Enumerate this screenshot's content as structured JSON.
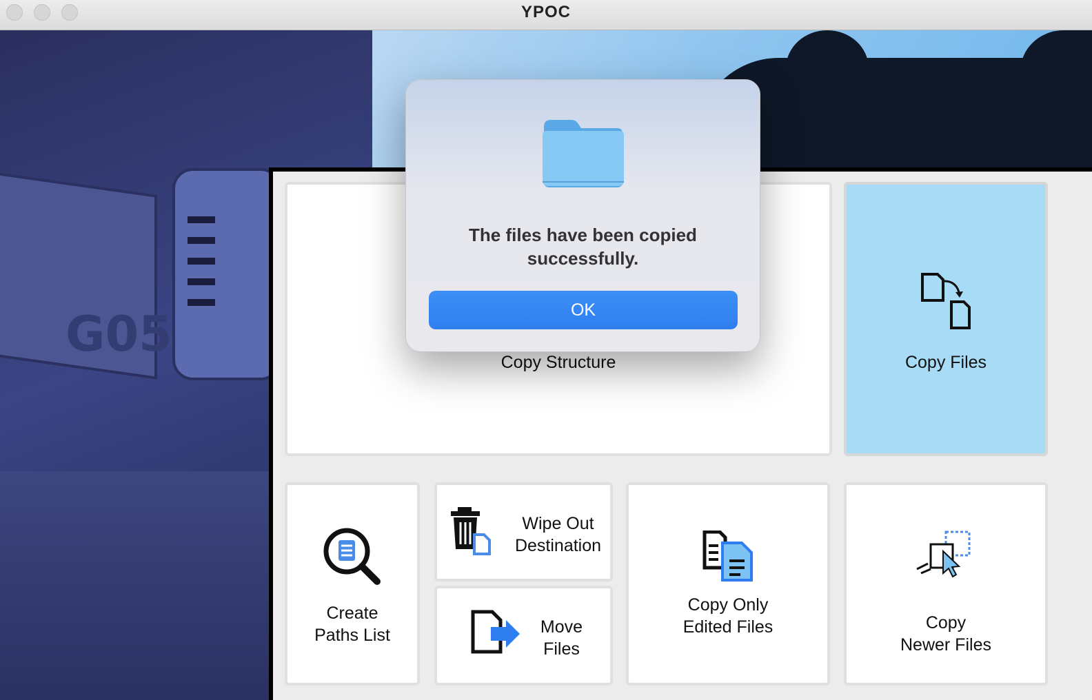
{
  "window": {
    "title": "YPOC"
  },
  "wallpaper": {
    "text": "G05"
  },
  "tiles": {
    "copy_structure": "Copy Structure",
    "copy_files": "Copy Files",
    "create_paths_list": [
      "Create",
      "Paths List"
    ],
    "wipe_out_destination": [
      "Wipe Out",
      "Destination"
    ],
    "move_files": [
      "Move",
      "Files"
    ],
    "copy_only_edited_files": [
      "Copy Only",
      "Edited Files"
    ],
    "copy_newer_files": [
      "Copy",
      "Newer Files"
    ]
  },
  "dialog": {
    "message_line1": "The files have been copied",
    "message_line2": "successfully.",
    "ok_label": "OK"
  },
  "colors": {
    "accent": "#2f7ef0",
    "selected_tile": "#a8dcf6",
    "folder": "#7cc2f2"
  },
  "icons": [
    "folder-icon",
    "copy-files-icon",
    "magnifier-document-icon",
    "trash-document-icon",
    "move-document-icon",
    "copy-edited-files-icon",
    "copy-newer-files-icon"
  ]
}
